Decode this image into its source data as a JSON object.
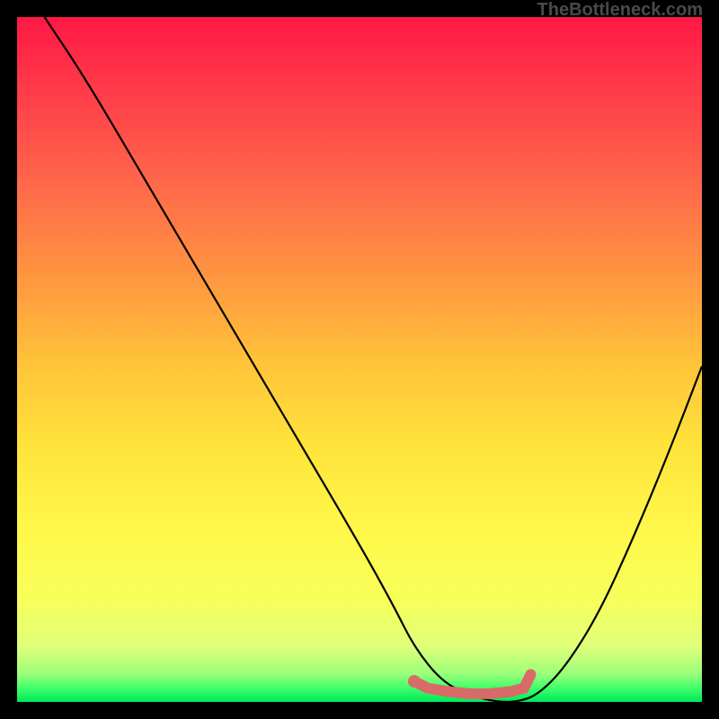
{
  "watermark": "TheBottleneck.com",
  "chart_data": {
    "type": "line",
    "title": "",
    "xlabel": "",
    "ylabel": "",
    "xlim": [
      0,
      100
    ],
    "ylim": [
      0,
      100
    ],
    "series": [
      {
        "name": "bottleneck-curve",
        "color": "#000000",
        "x": [
          4,
          10,
          20,
          30,
          40,
          50,
          55,
          58,
          62,
          66,
          70,
          73,
          76,
          80,
          85,
          90,
          95,
          100
        ],
        "y": [
          100,
          91,
          74,
          57,
          40,
          23,
          14,
          8,
          3,
          1,
          0,
          0,
          1,
          5,
          13,
          24,
          36,
          49
        ]
      },
      {
        "name": "optimal-range",
        "color": "#d96a6a",
        "x": [
          58,
          60,
          63,
          66,
          69,
          72,
          74,
          75
        ],
        "y": [
          3,
          2,
          1.5,
          1.2,
          1.2,
          1.5,
          2,
          4
        ]
      }
    ],
    "gradient_stops": [
      {
        "pos": 0,
        "color": "#ff1845"
      },
      {
        "pos": 50,
        "color": "#ffc13a"
      },
      {
        "pos": 85,
        "color": "#f8ff5a"
      },
      {
        "pos": 100,
        "color": "#00e858"
      }
    ]
  }
}
